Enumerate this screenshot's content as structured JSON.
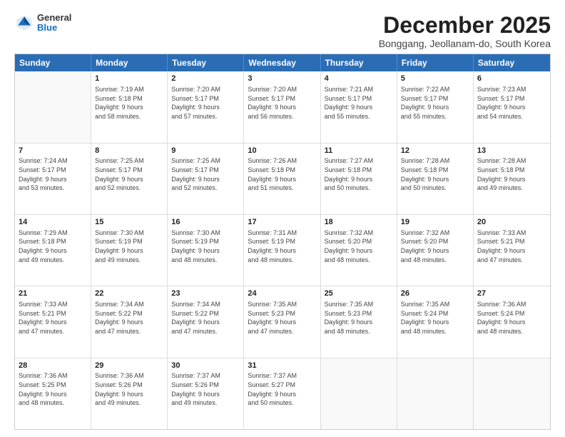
{
  "logo": {
    "general": "General",
    "blue": "Blue"
  },
  "title": "December 2025",
  "location": "Bonggang, Jeollanam-do, South Korea",
  "days": [
    "Sunday",
    "Monday",
    "Tuesday",
    "Wednesday",
    "Thursday",
    "Friday",
    "Saturday"
  ],
  "rows": [
    [
      {
        "day": "",
        "info": ""
      },
      {
        "day": "1",
        "info": "Sunrise: 7:19 AM\nSunset: 5:18 PM\nDaylight: 9 hours\nand 58 minutes."
      },
      {
        "day": "2",
        "info": "Sunrise: 7:20 AM\nSunset: 5:17 PM\nDaylight: 9 hours\nand 57 minutes."
      },
      {
        "day": "3",
        "info": "Sunrise: 7:20 AM\nSunset: 5:17 PM\nDaylight: 9 hours\nand 56 minutes."
      },
      {
        "day": "4",
        "info": "Sunrise: 7:21 AM\nSunset: 5:17 PM\nDaylight: 9 hours\nand 55 minutes."
      },
      {
        "day": "5",
        "info": "Sunrise: 7:22 AM\nSunset: 5:17 PM\nDaylight: 9 hours\nand 55 minutes."
      },
      {
        "day": "6",
        "info": "Sunrise: 7:23 AM\nSunset: 5:17 PM\nDaylight: 9 hours\nand 54 minutes."
      }
    ],
    [
      {
        "day": "7",
        "info": "Sunrise: 7:24 AM\nSunset: 5:17 PM\nDaylight: 9 hours\nand 53 minutes."
      },
      {
        "day": "8",
        "info": "Sunrise: 7:25 AM\nSunset: 5:17 PM\nDaylight: 9 hours\nand 52 minutes."
      },
      {
        "day": "9",
        "info": "Sunrise: 7:25 AM\nSunset: 5:17 PM\nDaylight: 9 hours\nand 52 minutes."
      },
      {
        "day": "10",
        "info": "Sunrise: 7:26 AM\nSunset: 5:18 PM\nDaylight: 9 hours\nand 51 minutes."
      },
      {
        "day": "11",
        "info": "Sunrise: 7:27 AM\nSunset: 5:18 PM\nDaylight: 9 hours\nand 50 minutes."
      },
      {
        "day": "12",
        "info": "Sunrise: 7:28 AM\nSunset: 5:18 PM\nDaylight: 9 hours\nand 50 minutes."
      },
      {
        "day": "13",
        "info": "Sunrise: 7:28 AM\nSunset: 5:18 PM\nDaylight: 9 hours\nand 49 minutes."
      }
    ],
    [
      {
        "day": "14",
        "info": "Sunrise: 7:29 AM\nSunset: 5:18 PM\nDaylight: 9 hours\nand 49 minutes."
      },
      {
        "day": "15",
        "info": "Sunrise: 7:30 AM\nSunset: 5:19 PM\nDaylight: 9 hours\nand 49 minutes."
      },
      {
        "day": "16",
        "info": "Sunrise: 7:30 AM\nSunset: 5:19 PM\nDaylight: 9 hours\nand 48 minutes."
      },
      {
        "day": "17",
        "info": "Sunrise: 7:31 AM\nSunset: 5:19 PM\nDaylight: 9 hours\nand 48 minutes."
      },
      {
        "day": "18",
        "info": "Sunrise: 7:32 AM\nSunset: 5:20 PM\nDaylight: 9 hours\nand 48 minutes."
      },
      {
        "day": "19",
        "info": "Sunrise: 7:32 AM\nSunset: 5:20 PM\nDaylight: 9 hours\nand 48 minutes."
      },
      {
        "day": "20",
        "info": "Sunrise: 7:33 AM\nSunset: 5:21 PM\nDaylight: 9 hours\nand 47 minutes."
      }
    ],
    [
      {
        "day": "21",
        "info": "Sunrise: 7:33 AM\nSunset: 5:21 PM\nDaylight: 9 hours\nand 47 minutes."
      },
      {
        "day": "22",
        "info": "Sunrise: 7:34 AM\nSunset: 5:22 PM\nDaylight: 9 hours\nand 47 minutes."
      },
      {
        "day": "23",
        "info": "Sunrise: 7:34 AM\nSunset: 5:22 PM\nDaylight: 9 hours\nand 47 minutes."
      },
      {
        "day": "24",
        "info": "Sunrise: 7:35 AM\nSunset: 5:23 PM\nDaylight: 9 hours\nand 47 minutes."
      },
      {
        "day": "25",
        "info": "Sunrise: 7:35 AM\nSunset: 5:23 PM\nDaylight: 9 hours\nand 48 minutes."
      },
      {
        "day": "26",
        "info": "Sunrise: 7:35 AM\nSunset: 5:24 PM\nDaylight: 9 hours\nand 48 minutes."
      },
      {
        "day": "27",
        "info": "Sunrise: 7:36 AM\nSunset: 5:24 PM\nDaylight: 9 hours\nand 48 minutes."
      }
    ],
    [
      {
        "day": "28",
        "info": "Sunrise: 7:36 AM\nSunset: 5:25 PM\nDaylight: 9 hours\nand 48 minutes."
      },
      {
        "day": "29",
        "info": "Sunrise: 7:36 AM\nSunset: 5:26 PM\nDaylight: 9 hours\nand 49 minutes."
      },
      {
        "day": "30",
        "info": "Sunrise: 7:37 AM\nSunset: 5:26 PM\nDaylight: 9 hours\nand 49 minutes."
      },
      {
        "day": "31",
        "info": "Sunrise: 7:37 AM\nSunset: 5:27 PM\nDaylight: 9 hours\nand 50 minutes."
      },
      {
        "day": "",
        "info": ""
      },
      {
        "day": "",
        "info": ""
      },
      {
        "day": "",
        "info": ""
      }
    ]
  ]
}
